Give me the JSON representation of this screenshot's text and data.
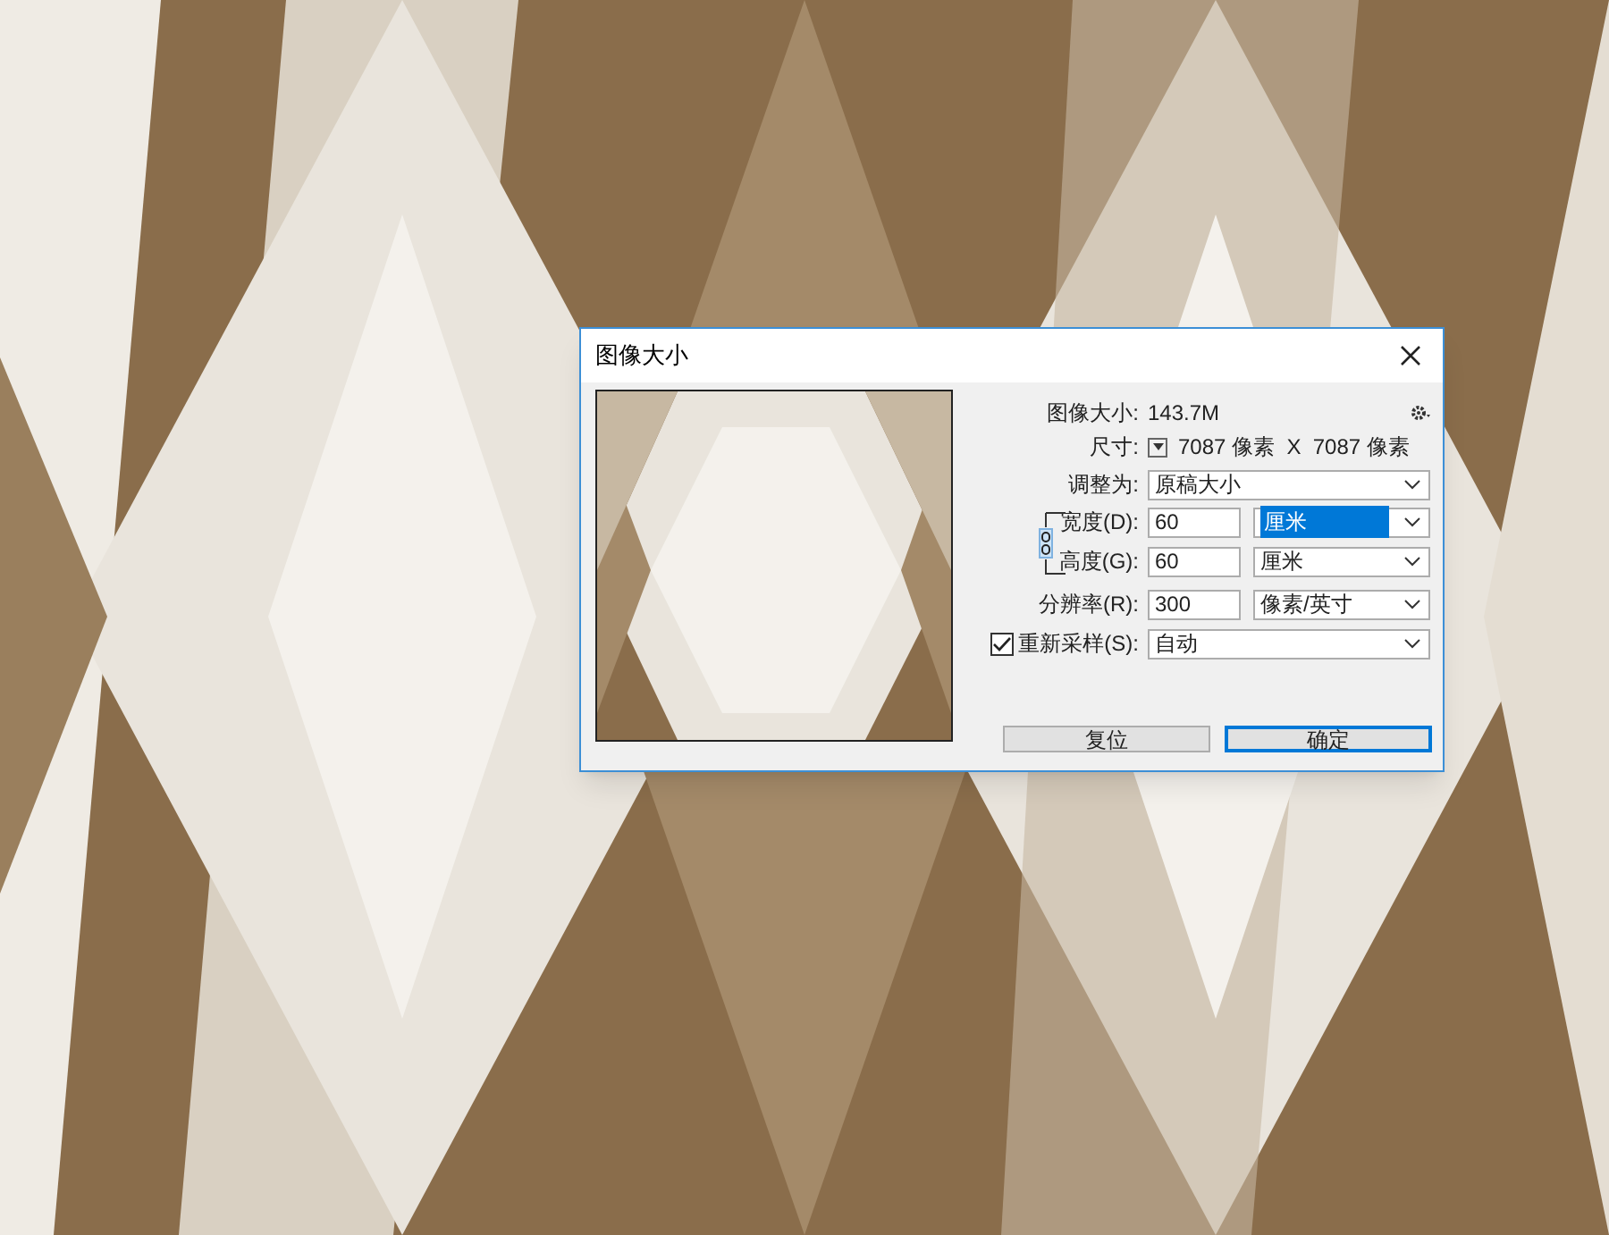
{
  "window": {
    "title": "图像大小"
  },
  "image_size": {
    "label": "图像大小:",
    "value": "143.7M"
  },
  "dimensions": {
    "label": "尺寸:",
    "value": "7087 像素  X  7087 像素"
  },
  "fit_to": {
    "label": "调整为:",
    "value": "原稿大小"
  },
  "fields": [
    {
      "label": "宽度(D):",
      "value": "60",
      "unit": "厘米",
      "selected": true
    },
    {
      "label": "高度(G):",
      "value": "60",
      "unit": "厘米",
      "selected": false
    },
    {
      "label": "分辨率(R):",
      "value": "300",
      "unit": "像素/英寸",
      "selected": false
    }
  ],
  "resample": {
    "label": "重新采样(S):",
    "checked": true,
    "value": "自动"
  },
  "buttons": [
    {
      "label": "复位",
      "default": false
    },
    {
      "label": "确定",
      "default": true
    }
  ]
}
